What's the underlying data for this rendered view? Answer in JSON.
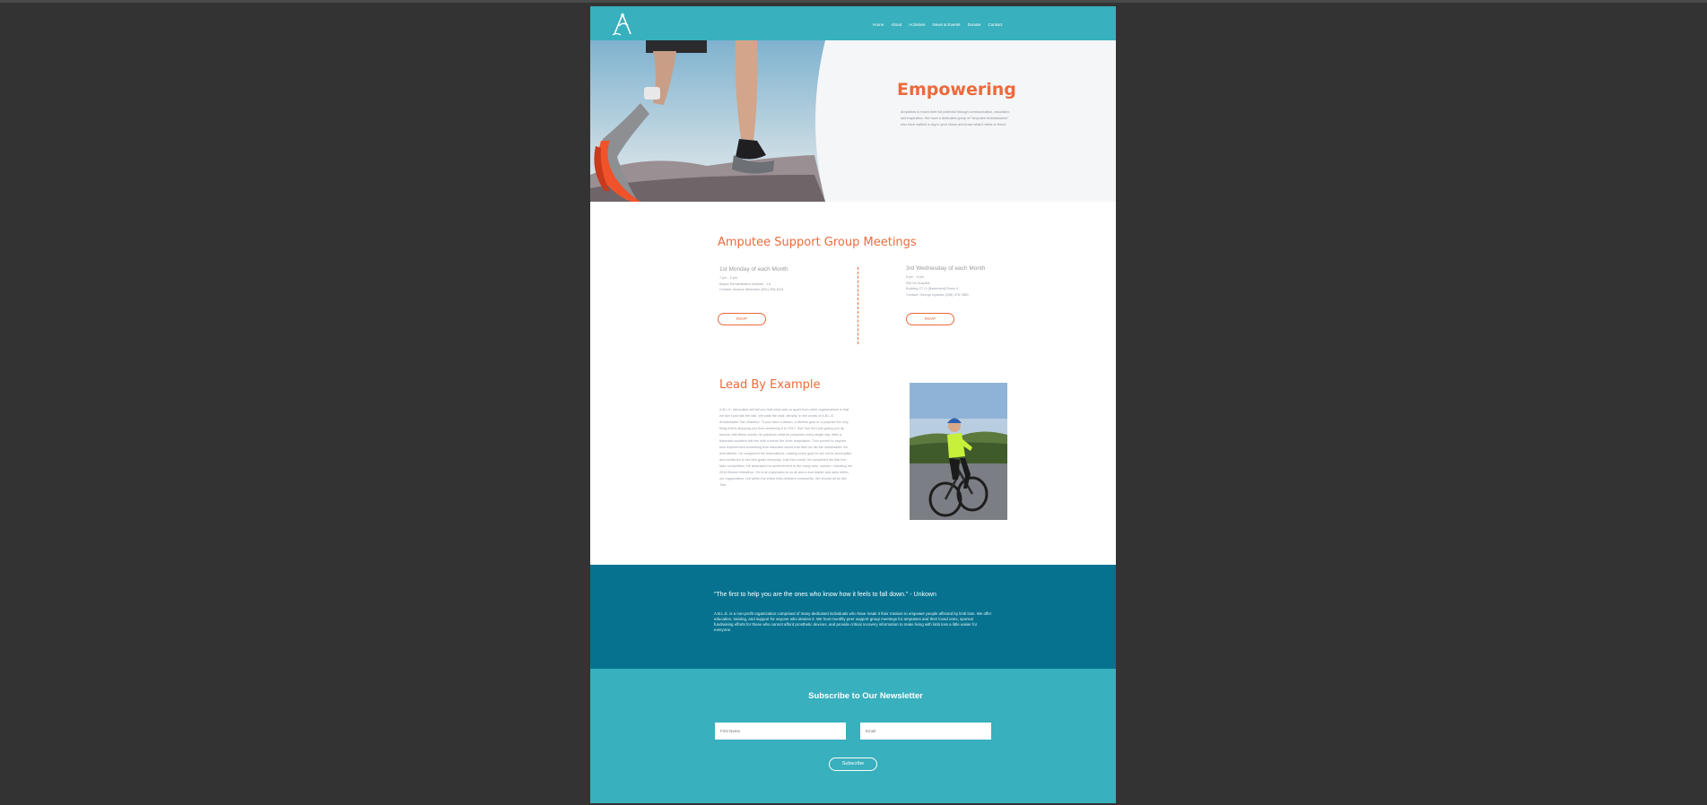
{
  "header": {
    "nav": [
      {
        "label": "Home"
      },
      {
        "label": "About"
      },
      {
        "label": "Activities"
      },
      {
        "label": "News & Events"
      },
      {
        "label": "Donate"
      },
      {
        "label": "Contact"
      }
    ]
  },
  "hero": {
    "title": "Empowering",
    "text": "Amputees to reach their full potential through communication, education, and inspiration. We have a dedicated group of \"Amputee Ambassadors\" who have walked a day in your shoes and know what it takes to thrive."
  },
  "meetings": {
    "title": "Amputee Support Group Meetings",
    "items": [
      {
        "heading": "1st Monday of each Month",
        "lines": [
          "7 pm - 9 pm",
          "Baylor Rehabilitation Institute - 1A",
          "Contact: Alvarez Melendez (801) 286-8411"
        ],
        "rsvp_label": "RSVP"
      },
      {
        "heading": "3rd Wednesday of each Month",
        "lines": [
          "6 pm - 8 pm",
          "RM VA Hospital",
          "Building C7 O (Basement) Room 6",
          "Contact: George Upsides (208) 378-7860"
        ],
        "rsvp_label": "RSVP"
      }
    ]
  },
  "lead": {
    "title": "Lead By Example",
    "text": "A.B.L.E. advocates will tell you that what sets us apart from other organizations is that we don't just talk the talk. We walk the walk, literally. In the words of A.B.L.E. Ambassador Tom Waldron: \"If you have a dream, a lifetime goal or a purpose the only thing that is stopping you from achieving it is YOU.\" But Tom isn't just giving you lip service with these words; he practices what he preaches every single day. After a traumatic accident left him with a below the knee amputation, Tom proved to anyone who experienced something that traumatic would that then he did the unthinkable. An avid athlete, he conquered his reservations, making every goal he set out to accomplish and continues to set new goals everyday. Just this month, he completed his first Iron Man competition. He dedicated his achievement to the many men, women, including the 2018 Boston Marathon. He is an inspiration to us all and a true leader and asks within our organization, but within the entire limb-deficient community. We should all be like Tom."
  },
  "quote_band": {
    "quote": "“The first to help you are the ones who know how it feels to fall down.” - Unkown",
    "about": "A.B.L.E. is a non-profit organization comprised of many dedicated individuals who have made it their mission to empower people affected by limb loss. We offer education, training, and support for anyone who desires it. We host monthly peer support group meetings for amputees and their loved ones, sponsor fundraising efforts for those who cannot afford prosthetic devices, and provide critical recovery information to make living with limb loss a little easier for everyone."
  },
  "newsletter": {
    "title": "Subscribe to Our Newsletter",
    "first_name_placeholder": "First Name",
    "email_placeholder": "Email",
    "subscribe_label": "Subscribe"
  },
  "colors": {
    "teal": "#38b0bd",
    "dark_teal": "#06728f",
    "accent": "#ec6a3c"
  }
}
